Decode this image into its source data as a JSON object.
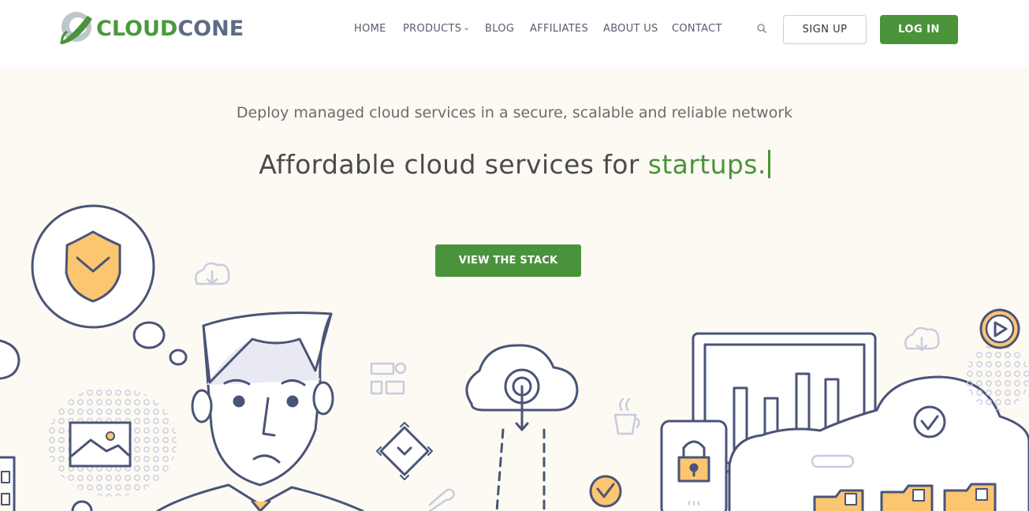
{
  "brand": {
    "logo_part1": "CLOUD",
    "logo_part2": "CONE",
    "green": "#4a933b",
    "slate": "#5d6b85"
  },
  "nav": {
    "items": [
      {
        "label": "HOME"
      },
      {
        "label": "PRODUCTS",
        "has_dropdown": true
      },
      {
        "label": "BLOG"
      },
      {
        "label": "AFFILIATES"
      },
      {
        "label": "ABOUT US"
      },
      {
        "label": "CONTACT"
      }
    ],
    "dropdown_icon": "chevron-down-icon",
    "search_icon": "search-icon",
    "signup_label": "SIGN UP",
    "login_label": "LOG IN"
  },
  "hero": {
    "subtitle": "Deploy managed cloud services in a secure, scalable and reliable network",
    "headline_prefix": "Affordable cloud services for ",
    "headline_accent": "startups.",
    "cta_label": "VIEW THE STACK",
    "background": "#fdfaf3"
  }
}
